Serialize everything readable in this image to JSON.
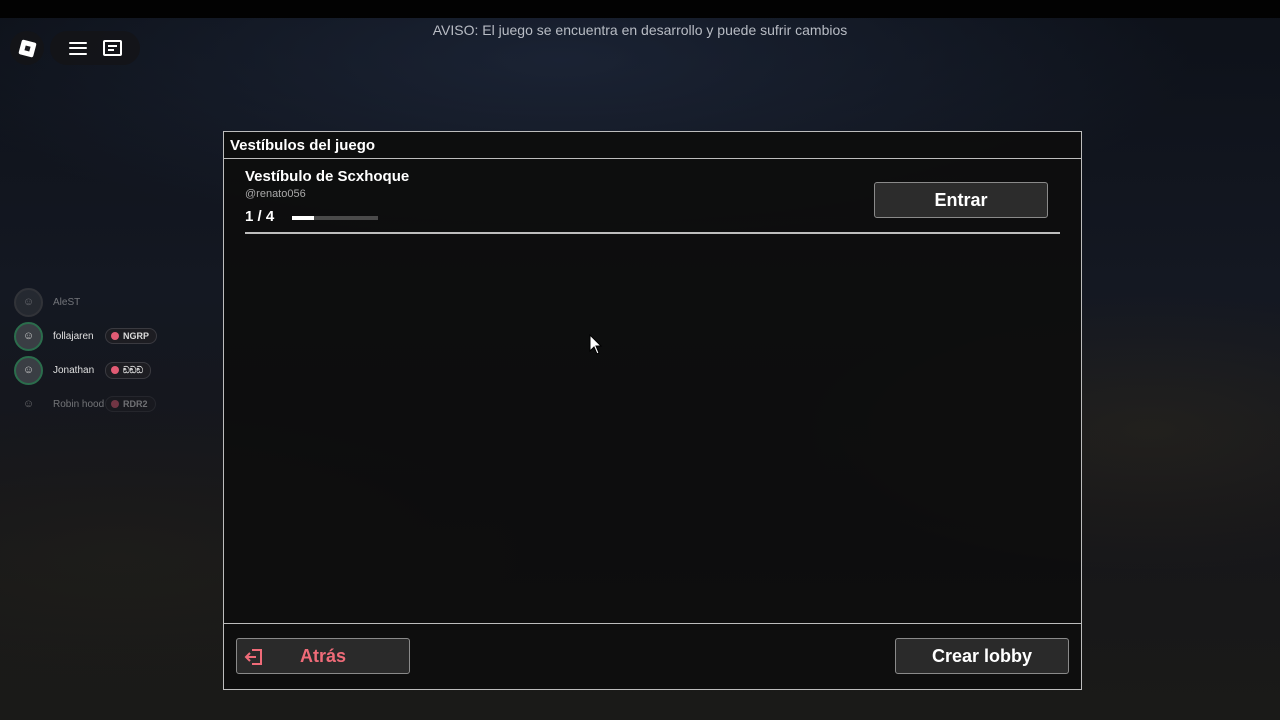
{
  "notice": "AVISO: El juego se encuentra en desarrollo y puede sufrir cambios",
  "topbar": {
    "icons": [
      "roblox-logo-icon",
      "menu-icon",
      "chat-icon"
    ]
  },
  "players": [
    {
      "name": "AleST",
      "tag": "",
      "faded": true
    },
    {
      "name": "follajaren",
      "tag": "NGRP"
    },
    {
      "name": "Jonathan",
      "tag": "ඞඞඞ"
    },
    {
      "name": "Robin hood",
      "tag": "RDR2",
      "faded": true
    }
  ],
  "panel": {
    "title": "Vestíbulos del juego",
    "lobbies": [
      {
        "name": "Vestíbulo de Scxhoque",
        "owner": "@renato056",
        "count": "1 / 4",
        "fill_fraction": 0.25,
        "enter_label": "Entrar"
      }
    ],
    "back_label": "Atrás",
    "create_label": "Crear lobby"
  },
  "colors": {
    "panel_bg": "#0e0e0e",
    "border": "#bdbdbd",
    "back_text": "#ef6b78",
    "button_bg": "#2c2c2c"
  }
}
